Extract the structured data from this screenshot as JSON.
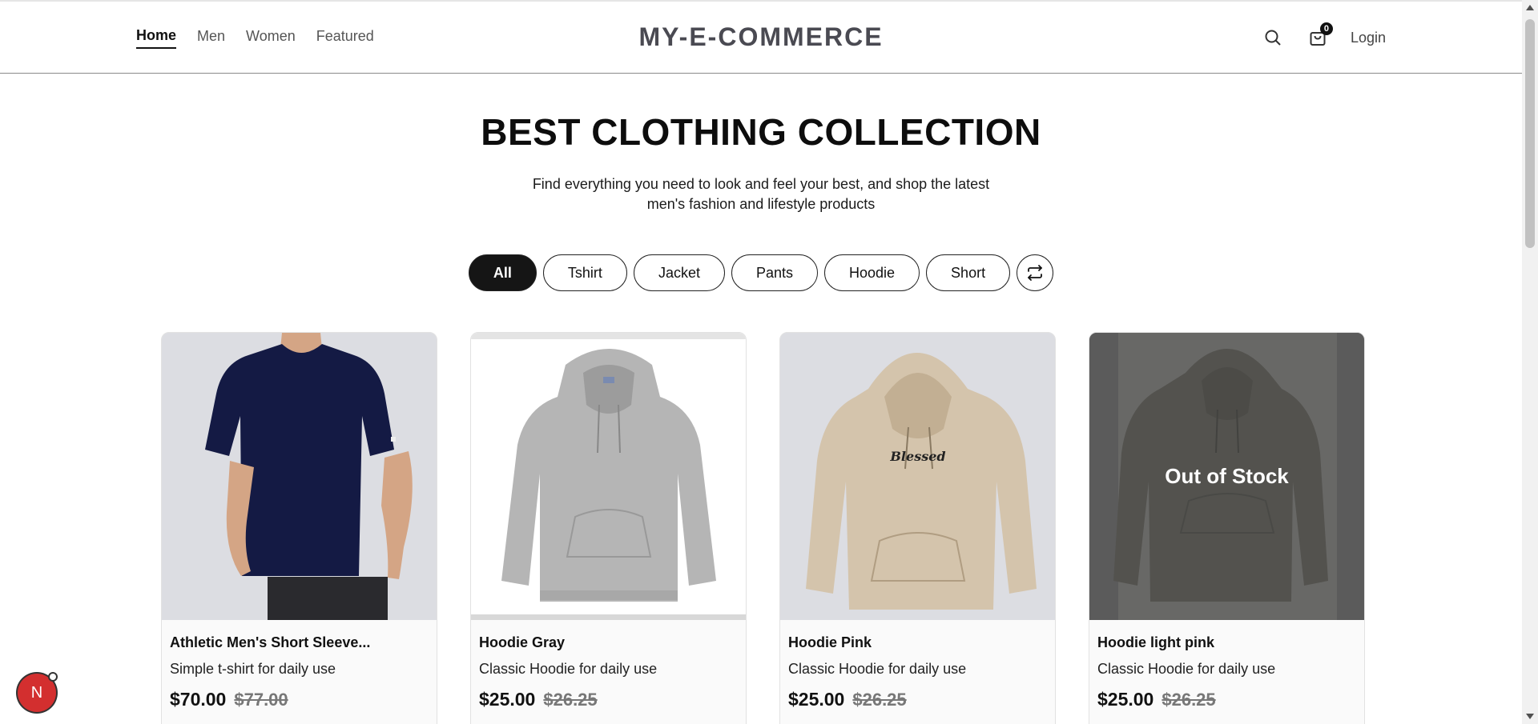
{
  "nav": {
    "links": [
      {
        "label": "Home",
        "active": true
      },
      {
        "label": "Men",
        "active": false
      },
      {
        "label": "Women",
        "active": false
      },
      {
        "label": "Featured",
        "active": false
      }
    ],
    "brand": "MY-E-COMMERCE",
    "cart_count": "0",
    "login_label": "Login"
  },
  "hero": {
    "title": "BEST CLOTHING COLLECTION",
    "subtitle": "Find everything you need to look and feel your best, and shop the latest men's fashion and lifestyle products"
  },
  "filters": [
    "All",
    "Tshirt",
    "Jacket",
    "Pants",
    "Hoodie",
    "Short"
  ],
  "active_filter": "All",
  "products": [
    {
      "name": "Athletic Men's Short Sleeve...",
      "description": "Simple t-shirt for daily use",
      "price": "$70.00",
      "old_price": "$77.00",
      "image": "navy-tshirt",
      "out_of_stock": false
    },
    {
      "name": "Hoodie Gray",
      "description": "Classic Hoodie for daily use",
      "price": "$25.00",
      "old_price": "$26.25",
      "image": "gray-hoodie",
      "out_of_stock": false
    },
    {
      "name": "Hoodie Pink",
      "description": "Classic Hoodie for daily use",
      "price": "$25.00",
      "old_price": "$26.25",
      "image": "beige-hoodie",
      "out_of_stock": false
    },
    {
      "name": "Hoodie light pink",
      "description": "Classic Hoodie for daily use",
      "price": "$25.00",
      "old_price": "$26.25",
      "image": "olive-hoodie",
      "out_of_stock": true,
      "stock_label": "Out of Stock"
    }
  ],
  "hoodie_print": "Blessed",
  "dev_badge": "N",
  "colors": {
    "accent": "#151515",
    "brand_text": "#4a4a52",
    "badge_red": "#d32f2f"
  }
}
